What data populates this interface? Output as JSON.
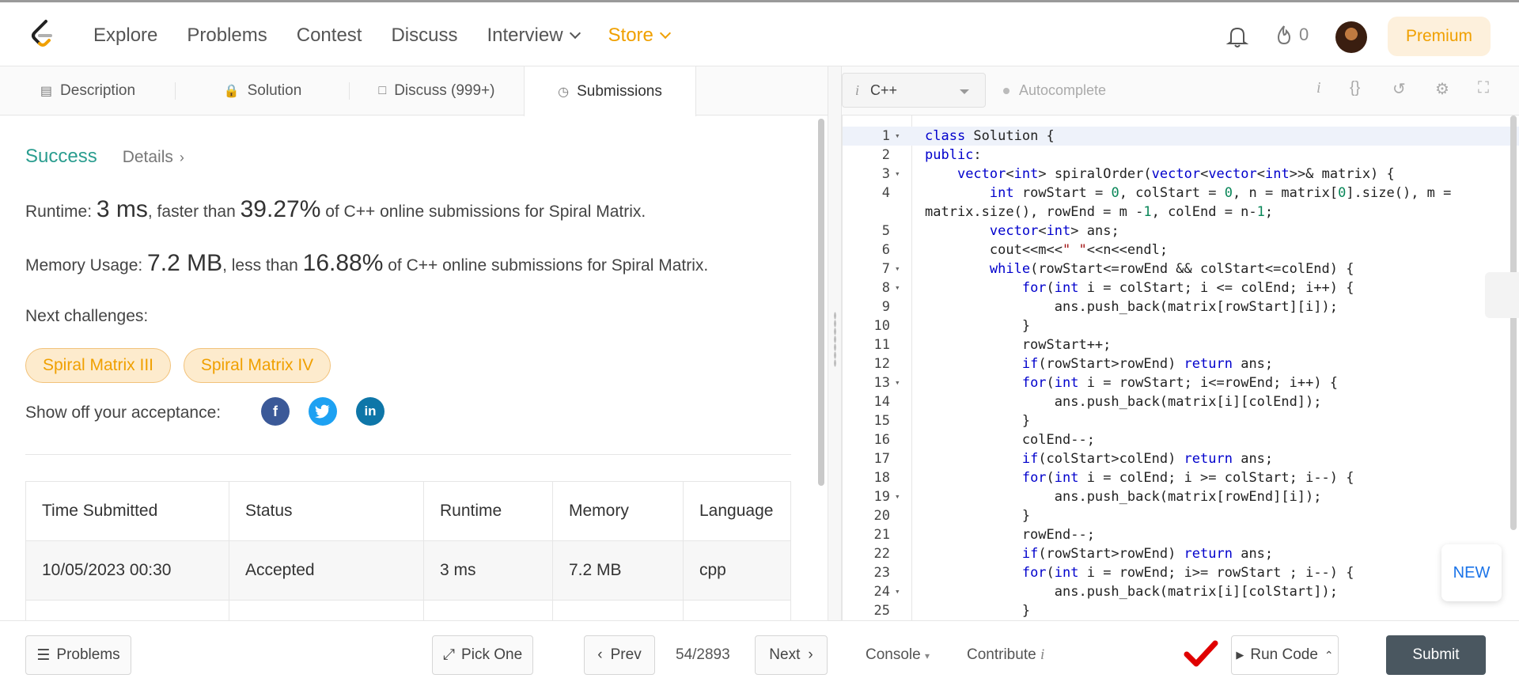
{
  "nav": {
    "items": [
      "Explore",
      "Problems",
      "Contest",
      "Discuss",
      "Interview",
      "Store"
    ],
    "streak_count": "0",
    "premium": "Premium"
  },
  "tabs": {
    "description": "Description",
    "solution": "Solution",
    "discuss": "Discuss (999+)",
    "submissions": "Submissions"
  },
  "result": {
    "status": "Success",
    "details": "Details",
    "runtime_label": "Runtime: ",
    "runtime_value": "3 ms",
    "runtime_mid": ", faster than ",
    "runtime_pct": "39.27%",
    "runtime_tail": " of C++ online submissions for Spiral Matrix.",
    "memory_label": "Memory Usage: ",
    "memory_value": "7.2 MB",
    "memory_mid": ", less than ",
    "memory_pct": "16.88%",
    "memory_tail": " of C++ online submissions for Spiral Matrix.",
    "next_challenges": "Next challenges:",
    "challenges": [
      "Spiral Matrix III",
      "Spiral Matrix IV"
    ],
    "share_label": "Show off your acceptance:"
  },
  "table": {
    "headers": [
      "Time Submitted",
      "Status",
      "Runtime",
      "Memory",
      "Language"
    ],
    "rows": [
      [
        "10/05/2023 00:30",
        "Accepted",
        "3 ms",
        "7.2 MB",
        "cpp"
      ]
    ]
  },
  "editor": {
    "language": "C++",
    "autocomplete": "Autocomplete"
  },
  "code_lines": [
    "class Solution {",
    "public:",
    "    vector<int> spiralOrder(vector<vector<int>>& matrix) {",
    "        int rowStart = 0, colStart = 0, n = matrix[0].size(), m =",
    "matrix.size(), rowEnd = m -1, colEnd = n-1;",
    "        vector<int> ans;",
    "        cout<<m<<\" \"<<n<<endl;",
    "        while(rowStart<=rowEnd && colStart<=colEnd) {",
    "            for(int i = colStart; i <= colEnd; i++) {",
    "                ans.push_back(matrix[rowStart][i]);",
    "            }",
    "            rowStart++;",
    "            if(rowStart>rowEnd) return ans;",
    "            for(int i = rowStart; i<=rowEnd; i++) {",
    "                ans.push_back(matrix[i][colEnd]);",
    "            }",
    "            colEnd--;",
    "            if(colStart>colEnd) return ans;",
    "            for(int i = colEnd; i >= colStart; i--) {",
    "                ans.push_back(matrix[rowEnd][i]);",
    "            }",
    "            rowEnd--;",
    "            if(rowStart>rowEnd) return ans;",
    "            for(int i = rowEnd; i>= rowStart ; i--) {",
    "                ans.push_back(matrix[i][colStart]);",
    "            }"
  ],
  "line_numbers": [
    "1",
    "2",
    "3",
    "4",
    "",
    "5",
    "6",
    "7",
    "8",
    "9",
    "10",
    "11",
    "12",
    "13",
    "14",
    "15",
    "16",
    "17",
    "18",
    "19",
    "20",
    "21",
    "22",
    "23",
    "24",
    "25"
  ],
  "fold_lines": [
    0,
    2,
    7,
    8,
    13,
    19,
    24
  ],
  "bottom": {
    "problems": "Problems",
    "pick_one": "Pick One",
    "prev": "Prev",
    "page": "54/2893",
    "next": "Next",
    "console": "Console",
    "contribute": "Contribute",
    "run_code": "Run Code",
    "submit": "Submit"
  },
  "new_badge": "NEW",
  "colors": {
    "accent": "#f0a000",
    "success": "#2a9d8f",
    "submit_bg": "#4a5760"
  }
}
